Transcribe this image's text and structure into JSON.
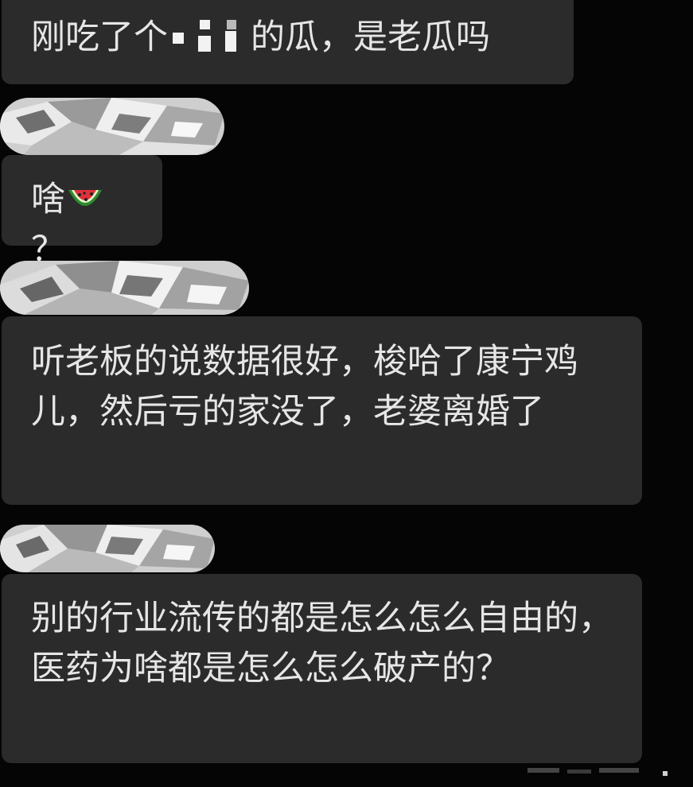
{
  "messages": [
    {
      "before": "刚吃了个",
      "after": "的瓜，是老瓜吗",
      "censored": true
    },
    {
      "text": "啥",
      "suffix": "？",
      "emoji": "watermelon-icon"
    },
    {
      "text": "听老板的说数据很好，梭哈了康宁鸡儿，然后亏的家没了，老婆离婚了"
    },
    {
      "text": "别的行业流传的都是怎么怎么自由的，医药为啥都是怎么怎么破产的？"
    }
  ],
  "colors": {
    "background": "#050505",
    "bubble": "#2b2b2b",
    "text": "#e6e6e6",
    "foil": "#cfcfcf"
  }
}
